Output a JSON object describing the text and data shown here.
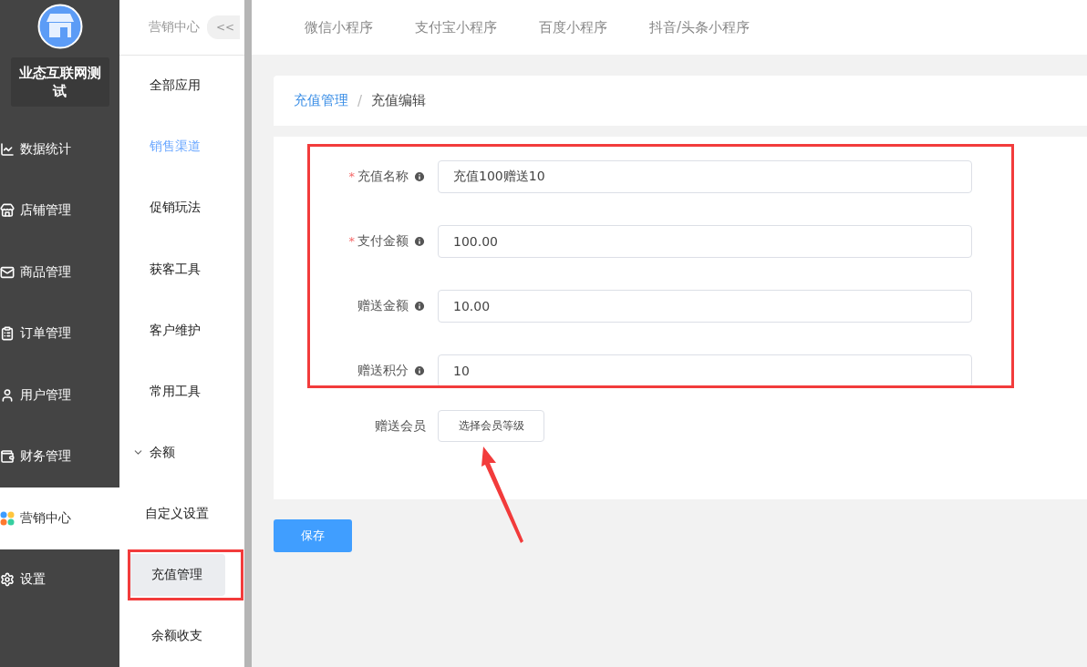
{
  "brand": {
    "name": "业态互联网测试"
  },
  "main_menu": [
    {
      "label": "数据统计",
      "selected": false
    },
    {
      "label": "店铺管理",
      "selected": false
    },
    {
      "label": "商品管理",
      "selected": false
    },
    {
      "label": "订单管理",
      "selected": false
    },
    {
      "label": "用户管理",
      "selected": false
    },
    {
      "label": "财务管理",
      "selected": false
    },
    {
      "label": "营销中心",
      "selected": true
    },
    {
      "label": "设置",
      "selected": false
    }
  ],
  "sub_header": {
    "title": "营销中心",
    "collapse": "<<"
  },
  "sub_menu": [
    {
      "label": "全部应用",
      "selected": false
    },
    {
      "label": "销售渠道",
      "selected": true
    },
    {
      "label": "促销玩法",
      "selected": false
    },
    {
      "label": "获客工具",
      "selected": false
    },
    {
      "label": "客户维护",
      "selected": false
    },
    {
      "label": "常用工具",
      "selected": false
    },
    {
      "label": "余额",
      "selected": false,
      "expanded": true,
      "children": [
        {
          "label": "自定义设置",
          "selected": false
        },
        {
          "label": "充值管理",
          "selected": true
        },
        {
          "label": "余额收支",
          "selected": false
        }
      ]
    }
  ],
  "tabs": [
    {
      "label": "微信小程序"
    },
    {
      "label": "支付宝小程序"
    },
    {
      "label": "百度小程序"
    },
    {
      "label": "抖音/头条小程序"
    }
  ],
  "breadcrumb": {
    "items": [
      "充值管理",
      "充值编辑"
    ],
    "separator": "/"
  },
  "form": {
    "required_mark": "*",
    "fields": [
      {
        "label": "充值名称",
        "required": true,
        "value": "充值100赠送10"
      },
      {
        "label": "支付金额",
        "required": true,
        "value": "100.00"
      },
      {
        "label": "赠送金额",
        "required": false,
        "value": "10.00"
      },
      {
        "label": "赠送积分",
        "required": false,
        "value": "10"
      }
    ],
    "member": {
      "label": "赠送会员",
      "button": "选择会员等级"
    }
  },
  "save_button": "保存"
}
